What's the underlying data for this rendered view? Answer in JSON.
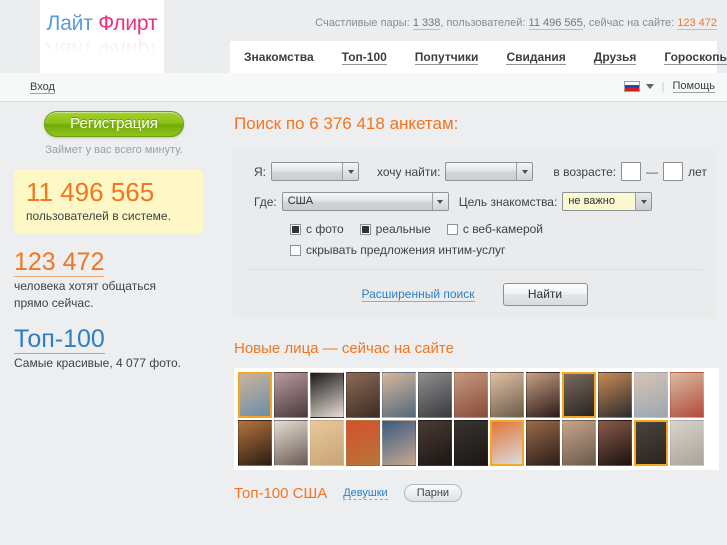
{
  "header": {
    "logo": {
      "part1": "Лайт ",
      "part2": "Флирт"
    },
    "stats_prefix": "Счастливые пары: ",
    "happy_pairs": "1 338",
    "stats_mid1": ", пользователей: ",
    "users_total": "11 496 565",
    "stats_mid2": ", сейчас на сайте: ",
    "online_now": "123 472",
    "nav": [
      {
        "label": "Знакомства",
        "active": true
      },
      {
        "label": "Топ-100",
        "active": false
      },
      {
        "label": "Попутчики",
        "active": false
      },
      {
        "label": "Свидания",
        "active": false
      },
      {
        "label": "Друзья",
        "active": false
      },
      {
        "label": "Гороскопы",
        "active": false
      }
    ]
  },
  "subbar": {
    "login_label": "Вход",
    "flag_icon": "russia-flag-icon",
    "dropdown_icon": "chevron-down-icon",
    "separator": "|",
    "help_label": "Помощь"
  },
  "sidebar": {
    "register_button": "Регистрация",
    "register_note": "Займет у вас всего минуту.",
    "users_count": "11 496 565",
    "users_caption": "пользователей в системе.",
    "online_count": "123 472",
    "online_caption_line1": "человека хотят общаться",
    "online_caption_line2": "прямо сейчас.",
    "top100_link": "Топ-100",
    "top100_caption": "Самые красивые, 4 077 фото."
  },
  "search": {
    "title": "Поиск по 6 376 418 анкетам:",
    "label_me": "Я:",
    "value_me": "",
    "label_find": "хочу найти:",
    "value_find": "",
    "label_age": "в возрасте:",
    "age_from": "",
    "age_to": "",
    "dash": "—",
    "age_unit": "лет",
    "label_where": "Где:",
    "value_where": "США",
    "label_goal": "Цель знакомства:",
    "value_goal": "не важно",
    "checkboxes": [
      {
        "label": "с фото",
        "checked": true
      },
      {
        "label": "реальные",
        "checked": true
      },
      {
        "label": "с веб-камерой",
        "checked": false
      }
    ],
    "checkbox_hide": {
      "label": "скрывать предложения интим-услуг",
      "checked": false
    },
    "advanced_link": "Расширенный поиск",
    "submit_label": "Найти"
  },
  "faces": {
    "title": "Новые лица — сейчас на сайте",
    "photos": [
      {
        "c1": "#c8b49a",
        "c2": "#6e8ca8",
        "hl": true
      },
      {
        "c1": "#b89aa0",
        "c2": "#4a3a3c",
        "hl": false
      },
      {
        "c1": "#1a1a1a",
        "c2": "#e8ddd4",
        "hl": false
      },
      {
        "c1": "#8a6a58",
        "c2": "#3e2c24",
        "hl": false
      },
      {
        "c1": "#d8b79a",
        "c2": "#53687e",
        "hl": false
      },
      {
        "c1": "#8e8e90",
        "c2": "#3b3b3d",
        "hl": false
      },
      {
        "c1": "#c49a80",
        "c2": "#8a4a3a",
        "hl": false
      },
      {
        "c1": "#e0c2a4",
        "c2": "#6d5a48",
        "hl": false
      },
      {
        "c1": "#c79f84",
        "c2": "#2c1c16",
        "hl": false
      },
      {
        "c1": "#7a6a60",
        "c2": "#2a2420",
        "hl": true
      },
      {
        "c1": "#c98b52",
        "c2": "#2b2b2f",
        "hl": false
      },
      {
        "c1": "#d7c4b4",
        "c2": "#9aa7b2",
        "hl": false
      },
      {
        "c1": "#d8bca4",
        "c2": "#b44a3a",
        "hl": false
      },
      {
        "c1": "#b4743c",
        "c2": "#2a1c14",
        "hl": false
      },
      {
        "c1": "#e6ddd2",
        "c2": "#6a5c54",
        "hl": false
      },
      {
        "c1": "#e8c89a",
        "c2": "#c8a478",
        "hl": false
      },
      {
        "c1": "#d4502c",
        "c2": "#b8763a",
        "hl": false
      },
      {
        "c1": "#3a5a80",
        "c2": "#c8a890",
        "hl": false
      },
      {
        "c1": "#4a3a34",
        "c2": "#1c1614",
        "hl": false
      },
      {
        "c1": "#3a3430",
        "c2": "#1a1614",
        "hl": false
      },
      {
        "c1": "#e0753a",
        "c2": "#dcdcdc",
        "hl": true
      },
      {
        "c1": "#9a6a4a",
        "c2": "#2a1e18",
        "hl": false
      },
      {
        "c1": "#c8a48a",
        "c2": "#6a5a4c",
        "hl": false
      },
      {
        "c1": "#8a5a4a",
        "c2": "#1c1210",
        "hl": false
      },
      {
        "c1": "#4a4440",
        "c2": "#2a2420",
        "hl": true
      },
      {
        "c1": "#d8d4cc",
        "c2": "#a8a49c",
        "hl": false
      }
    ]
  },
  "top100": {
    "title": "Топ-100 США",
    "girls_label": "Девушки",
    "guys_label": "Парни"
  }
}
